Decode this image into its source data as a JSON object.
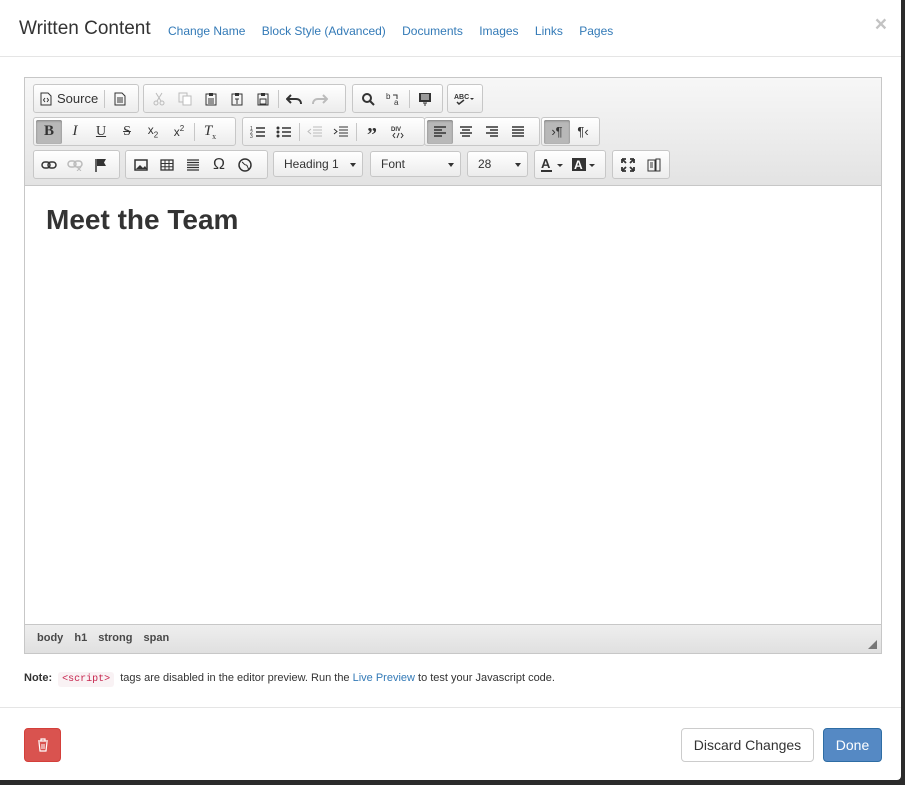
{
  "header": {
    "title": "Written Content",
    "links": [
      "Change Name",
      "Block Style (Advanced)",
      "Documents",
      "Images",
      "Links",
      "Pages"
    ],
    "close": "×"
  },
  "toolbar": {
    "source_label": "Source",
    "format_value": "Heading 1",
    "font_value": "Font",
    "size_value": "28"
  },
  "editor": {
    "heading": "Meet the Team",
    "path": [
      "body",
      "h1",
      "strong",
      "span"
    ]
  },
  "note": {
    "label": "Note:",
    "code": "<script>",
    "text_before": " tags are disabled in the editor preview. Run the ",
    "link": "Live Preview",
    "text_after": " to test your Javascript code."
  },
  "footer": {
    "discard_label": "Discard Changes",
    "done_label": "Done"
  },
  "colors": {
    "link": "#337ab7",
    "primary": "#5589c4",
    "danger": "#d9534f"
  }
}
